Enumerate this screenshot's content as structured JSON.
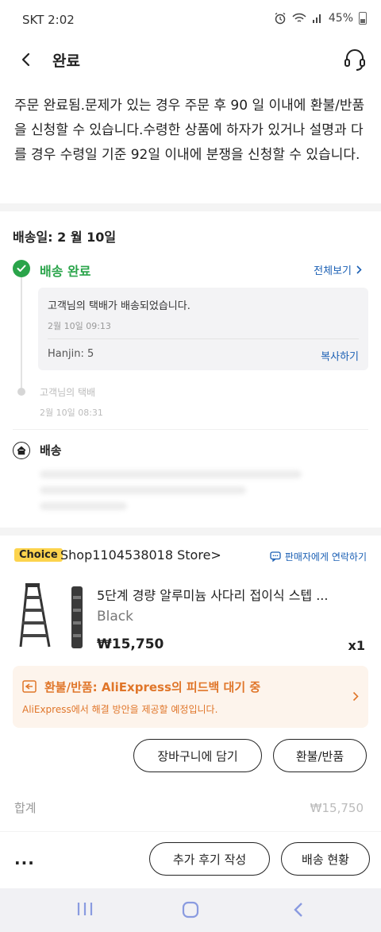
{
  "status_bar": {
    "carrier_time": "SKT 2:02",
    "battery": "45%"
  },
  "header": {
    "title": "완료"
  },
  "notice": "주문 완료됨.문제가 있는 경우 주문 후 90 일 이내에 환불/반품을 신청할 수 있습니다.수령한 상품에 하자가 있거나 설명과 다를 경우 수령일 기준 92일 이내에 분쟁을 신청할 수 있습니다.",
  "delivery": {
    "date_label": "배송일: 2 월 10일",
    "status": "배송 완료",
    "view_all": "전체보기",
    "events": [
      {
        "message": "고객님의 택배가 배송되었습니다.",
        "time": "2월 10일 09:13",
        "carrier": "Hanjin: 5",
        "copy": "복사하기"
      },
      {
        "message": "고객님의 택배",
        "time": "2월 10일 08:31"
      }
    ],
    "address_title": "배송"
  },
  "order": {
    "badge": "Choice",
    "store": "Shop1104538018 Store>",
    "contact_seller": "판매자에게 연락하기",
    "product": {
      "title": "5단계 경량 알루미늄 사다리 접이식 스텝 ...",
      "variant": "Black",
      "price": "₩15,750",
      "qty": "x1"
    },
    "refund": {
      "title": "환불/반품: AliExpress의 피드백 대기 중",
      "subtitle": "AliExpress에서 해결 방안을 제공할 예정입니다."
    },
    "add_cart": "장바구니에 담기",
    "refund_button": "환불/반품"
  },
  "total": {
    "label": "합계",
    "value": "₩15,750"
  },
  "bottom": {
    "more": "...",
    "review": "추가 후기 작성",
    "tracking": "배송 현황"
  },
  "colors": {
    "green": "#2aa44a",
    "blue": "#1a5fb4",
    "orange": "#e0762a",
    "choice_yellow": "#fcd34d"
  }
}
